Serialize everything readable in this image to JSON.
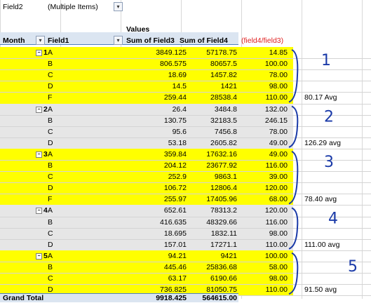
{
  "filter": {
    "field_label": "Field2",
    "value": "(Multiple Items)"
  },
  "headers": {
    "values_caption": "Values",
    "month": "Month",
    "field1": "Field1",
    "sum3": "Sum of Field3",
    "sum4": "Sum of Field4",
    "ratio": "(field4/field3)"
  },
  "groups": [
    {
      "month": "1",
      "band": "yellow",
      "rows": [
        {
          "f1": "A",
          "f3": "3849.125",
          "f4": "57178.75",
          "r": "14.85"
        },
        {
          "f1": "B",
          "f3": "806.575",
          "f4": "80657.5",
          "r": "100.00"
        },
        {
          "f1": "C",
          "f3": "18.69",
          "f4": "1457.82",
          "r": "78.00"
        },
        {
          "f1": "D",
          "f3": "14.5",
          "f4": "1421",
          "r": "98.00"
        },
        {
          "f1": "F",
          "f3": "259.44",
          "f4": "28538.4",
          "r": "110.00"
        }
      ],
      "avg": "80.17  Avg",
      "ink": "1"
    },
    {
      "month": "2",
      "band": "gray",
      "rows": [
        {
          "f1": "A",
          "f3": "26.4",
          "f4": "3484.8",
          "r": "132.00"
        },
        {
          "f1": "B",
          "f3": "130.75",
          "f4": "32183.5",
          "r": "246.15"
        },
        {
          "f1": "C",
          "f3": "95.6",
          "f4": "7456.8",
          "r": "78.00"
        },
        {
          "f1": "D",
          "f3": "53.18",
          "f4": "2605.82",
          "r": "49.00"
        }
      ],
      "avg": "126.29  avg",
      "ink": "2"
    },
    {
      "month": "3",
      "band": "yellow",
      "rows": [
        {
          "f1": "A",
          "f3": "359.84",
          "f4": "17632.16",
          "r": "49.00"
        },
        {
          "f1": "B",
          "f3": "204.12",
          "f4": "23677.92",
          "r": "116.00"
        },
        {
          "f1": "C",
          "f3": "252.9",
          "f4": "9863.1",
          "r": "39.00"
        },
        {
          "f1": "D",
          "f3": "106.72",
          "f4": "12806.4",
          "r": "120.00"
        },
        {
          "f1": "F",
          "f3": "255.97",
          "f4": "17405.96",
          "r": "68.00"
        }
      ],
      "avg": "78.40  avg",
      "ink": "3"
    },
    {
      "month": "4",
      "band": "gray",
      "rows": [
        {
          "f1": "A",
          "f3": "652.61",
          "f4": "78313.2",
          "r": "120.00"
        },
        {
          "f1": "B",
          "f3": "416.635",
          "f4": "48329.66",
          "r": "116.00"
        },
        {
          "f1": "C",
          "f3": "18.695",
          "f4": "1832.11",
          "r": "98.00"
        },
        {
          "f1": "D",
          "f3": "157.01",
          "f4": "17271.1",
          "r": "110.00"
        }
      ],
      "avg": "111.00  avg",
      "ink": "4"
    },
    {
      "month": "5",
      "band": "yellow",
      "rows": [
        {
          "f1": "A",
          "f3": "94.21",
          "f4": "9421",
          "r": "100.00"
        },
        {
          "f1": "B",
          "f3": "445.46",
          "f4": "25836.68",
          "r": "58.00"
        },
        {
          "f1": "C",
          "f3": "63.17",
          "f4": "6190.66",
          "r": "98.00"
        },
        {
          "f1": "D",
          "f3": "736.825",
          "f4": "81050.75",
          "r": "110.00"
        }
      ],
      "avg": "91.50  avg",
      "ink": "5"
    }
  ],
  "grand_total": {
    "label": "Grand Total",
    "f3": "9918.425",
    "f4": "564615.00"
  },
  "colors": {
    "highlight": "#ffff00",
    "alt_band": "#e6e6e6",
    "ink": "#1a3aa8",
    "ratio_header": "#e02020"
  }
}
